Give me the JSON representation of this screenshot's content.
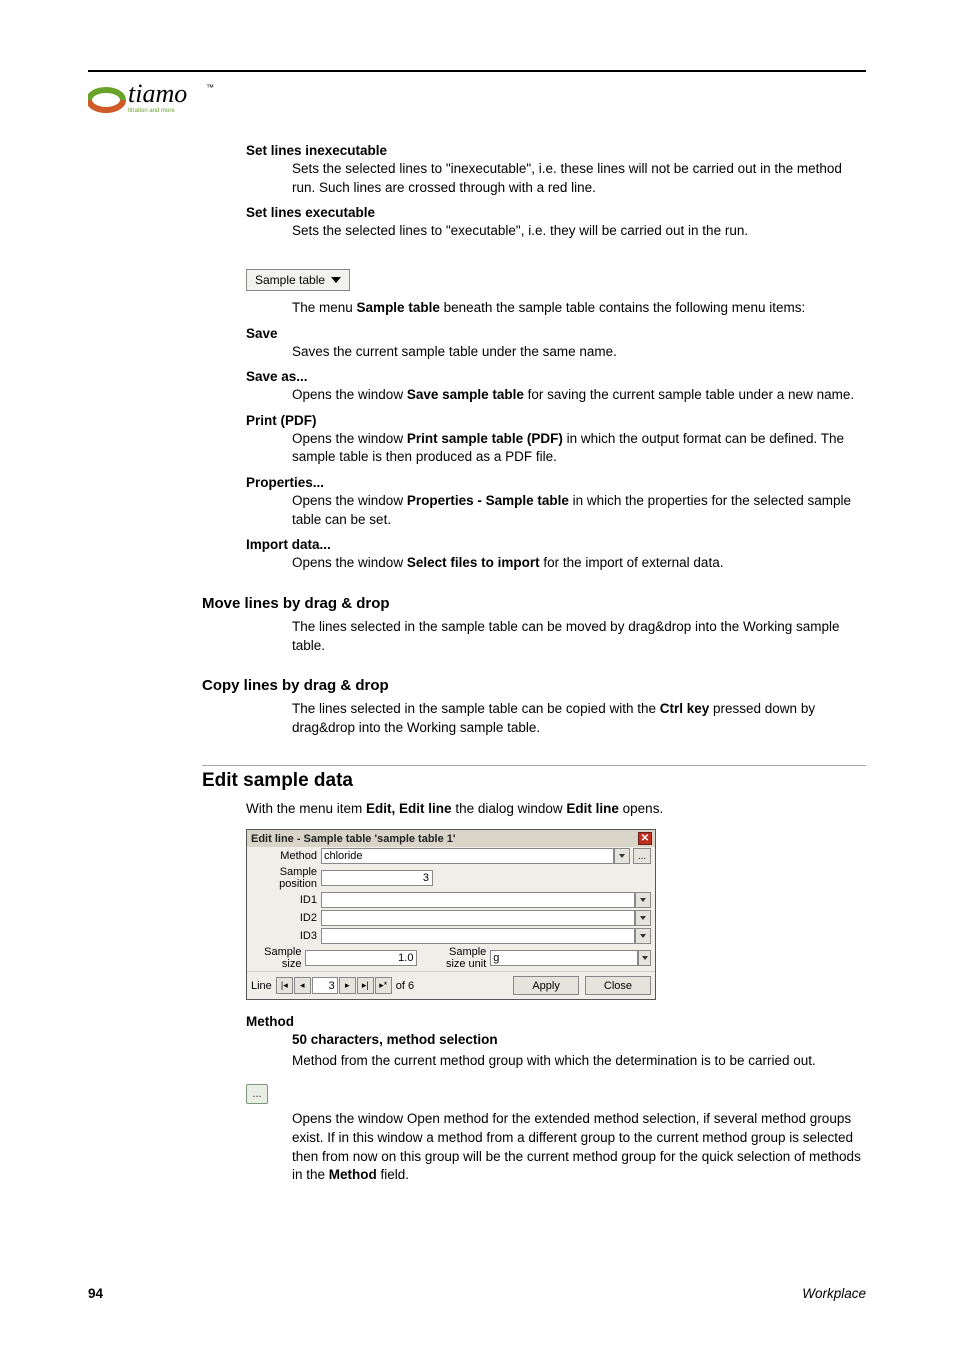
{
  "logo": {
    "text": "tiamo",
    "tm": "™",
    "tagline": "titration and more"
  },
  "setLinesInexec": {
    "term": "Set lines inexecutable",
    "desc": "Sets the selected lines to \"inexecutable\", i.e. these lines will not be carried out in the method run. Such lines are crossed through with a red line."
  },
  "setLinesExec": {
    "term": "Set lines executable",
    "desc": "Sets the selected lines to \"executable\", i.e. they will be carried out in the run."
  },
  "sampleBtn": {
    "label": "Sample table"
  },
  "sampleIntro": {
    "p1a": "The menu ",
    "p1b": "Sample table",
    "p1c": " beneath the sample table contains the following menu items:"
  },
  "save": {
    "term": "Save",
    "desc": "Saves the current sample table under the same name."
  },
  "saveAs": {
    "term": "Save as...",
    "d1": "Opens the window ",
    "b": "Save sample table",
    "d2": " for saving the current sample table under a new name."
  },
  "printPdf": {
    "term": "Print (PDF)",
    "d1": "Opens the window ",
    "b": "Print sample table (PDF)",
    "d2": " in which the output format can be defined. The sample table is then produced as a PDF file."
  },
  "props": {
    "term": "Properties...",
    "d1": "Opens the window ",
    "b": "Properties - Sample table",
    "d2": " in which the properties for the selected sample table can be set."
  },
  "importData": {
    "term": "Import data...",
    "d1": "Opens the window ",
    "b": "Select files to import",
    "d2": " for the import of external data."
  },
  "moveLines": {
    "title": "Move lines by drag & drop",
    "desc": "The lines selected in the sample table can be moved by drag&drop into the Working sample table."
  },
  "copyLines": {
    "title": "Copy lines by drag & drop",
    "d1": "The lines selected in the sample table can be copied with the ",
    "b": "Ctrl key",
    "d2": " pressed down by drag&drop into the Working sample table."
  },
  "editSample": {
    "title": "Edit sample data",
    "p1a": "With the menu item ",
    "p1b": "Edit, Edit line",
    "p1c": " the dialog window ",
    "p1d": "Edit line",
    "p1e": " opens."
  },
  "dialog": {
    "title": "Edit line - Sample table 'sample table 1'",
    "method_lbl": "Method",
    "method_val": "chloride",
    "samplepos_lbl": "Sample position",
    "samplepos_val": "3",
    "id1_lbl": "ID1",
    "id2_lbl": "ID2",
    "id3_lbl": "ID3",
    "size_lbl": "Sample size",
    "size_val": "1.0",
    "unit_lbl": "Sample size unit",
    "unit_val": "g",
    "line_lbl": "Line",
    "line_val": "3",
    "of_total": "of 6",
    "apply": "Apply",
    "close": "Close"
  },
  "methodSec": {
    "term": "Method",
    "sub": "50 characters, method selection",
    "desc": "Method from the current method group with which the determination is to be carried out."
  },
  "openMethod": {
    "p1": "Opens the window Open method for the extended method selection, if several method groups exist. If in this window a method from a different group to the current method group is selected then from now on this group will be the current method group for the quick selection of methods in the ",
    "b": "Method",
    "p2": " field."
  },
  "footer": {
    "page": "94",
    "section": "Workplace"
  }
}
